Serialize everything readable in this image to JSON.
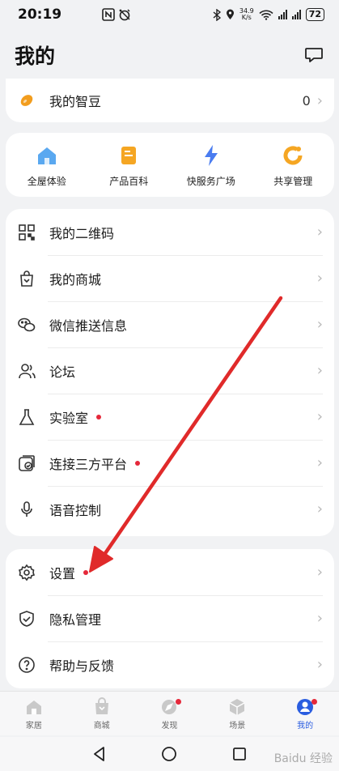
{
  "status": {
    "time": "20:19",
    "netspeed_top": "34.9",
    "netspeed_bottom": "K/s",
    "battery": "72"
  },
  "header": {
    "title": "我的"
  },
  "beans": {
    "label": "我的智豆",
    "value": "0"
  },
  "quick": [
    {
      "label": "全屋体验",
      "icon": "house-icon"
    },
    {
      "label": "产品百科",
      "icon": "book-icon"
    },
    {
      "label": "快服务广场",
      "icon": "bolt-icon"
    },
    {
      "label": "共享管理",
      "icon": "share-icon"
    }
  ],
  "menu1": [
    {
      "label": "我的二维码",
      "icon": "qrcode-icon",
      "dot": false
    },
    {
      "label": "我的商城",
      "icon": "shopping-bag-icon",
      "dot": false
    },
    {
      "label": "微信推送信息",
      "icon": "wechat-icon",
      "dot": false
    },
    {
      "label": "论坛",
      "icon": "people-icon",
      "dot": false
    },
    {
      "label": "实验室",
      "icon": "flask-icon",
      "dot": true
    },
    {
      "label": "连接三方平台",
      "icon": "link-platform-icon",
      "dot": true
    },
    {
      "label": "语音控制",
      "icon": "microphone-icon",
      "dot": false
    }
  ],
  "menu2": [
    {
      "label": "设置",
      "icon": "gear-icon",
      "dot": true
    },
    {
      "label": "隐私管理",
      "icon": "shield-icon",
      "dot": false
    },
    {
      "label": "帮助与反馈",
      "icon": "help-icon",
      "dot": false
    }
  ],
  "tabs": [
    {
      "label": "家居",
      "active": false,
      "badge": false
    },
    {
      "label": "商城",
      "active": false,
      "badge": false
    },
    {
      "label": "发现",
      "active": false,
      "badge": true
    },
    {
      "label": "场景",
      "active": false,
      "badge": false
    },
    {
      "label": "我的",
      "active": true,
      "badge": true
    }
  ],
  "watermark": "Baidu 经验",
  "colors": {
    "accent": "#2a5de0",
    "dot": "#e5283a",
    "arrow": "#e02a2a",
    "background": "#f1f2f4"
  }
}
